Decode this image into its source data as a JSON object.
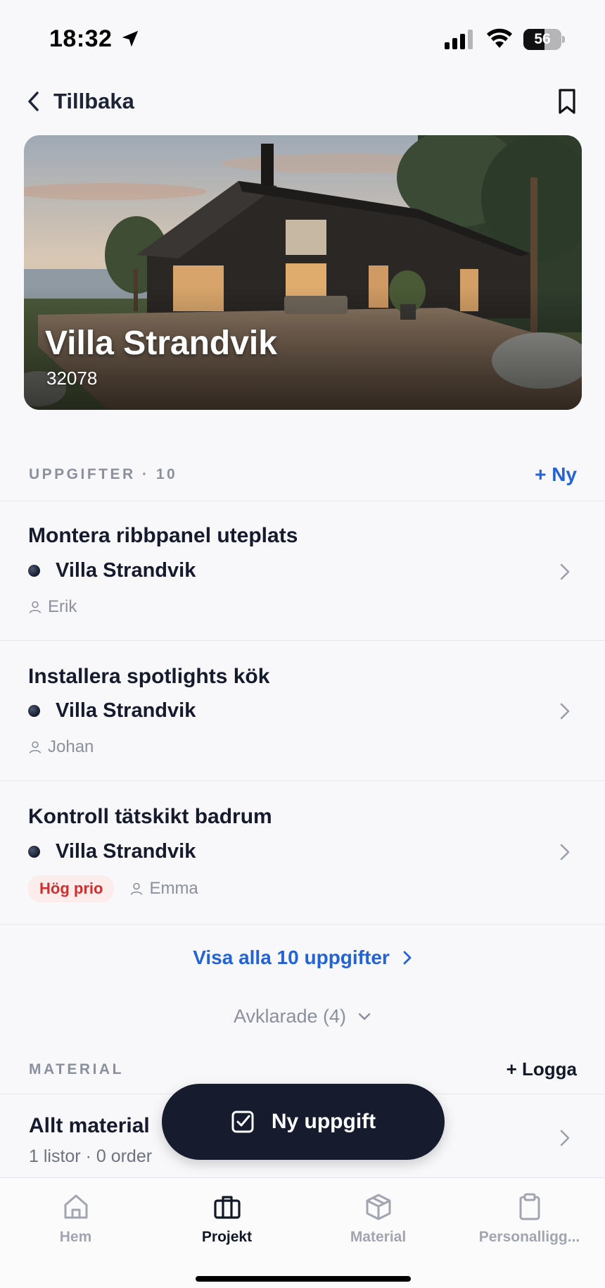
{
  "status_bar": {
    "time": "18:32",
    "battery": "56",
    "battery_level": 0.56
  },
  "nav": {
    "back_label": "Tillbaka"
  },
  "hero": {
    "title": "Villa Strandvik",
    "subtitle": "32078"
  },
  "tasks_section": {
    "label": "UPPGIFTER · 10",
    "new_label": "+ Ny",
    "items": [
      {
        "title": "Montera ribbpanel uteplats",
        "project": "Villa Strandvik",
        "assignee": "Erik",
        "priority": ""
      },
      {
        "title": "Installera spotlights kök",
        "project": "Villa Strandvik",
        "assignee": "Johan",
        "priority": ""
      },
      {
        "title": "Kontroll tätskikt badrum",
        "project": "Villa Strandvik",
        "assignee": "Emma",
        "priority": "Hög prio"
      }
    ],
    "show_all_label": "Visa alla 10 uppgifter",
    "completed_label": "Avklarade (4)"
  },
  "material_section": {
    "label": "MATERIAL",
    "log_label": "+ Logga",
    "row_title": "Allt material",
    "row_subtitle": "1 listor · 0 order"
  },
  "fab": {
    "label": "Ny uppgift"
  },
  "tab_bar": {
    "tabs": [
      {
        "label": "Hem",
        "icon": "home-icon",
        "active": false
      },
      {
        "label": "Projekt",
        "icon": "briefcase-icon",
        "active": true
      },
      {
        "label": "Material",
        "icon": "box-icon",
        "active": false
      },
      {
        "label": "Personalligg...",
        "icon": "clipboard-icon",
        "active": false
      }
    ]
  },
  "colors": {
    "accent": "#2463d6",
    "dark": "#161c2d",
    "priority": "#d12f2f",
    "muted": "#8a909c"
  }
}
